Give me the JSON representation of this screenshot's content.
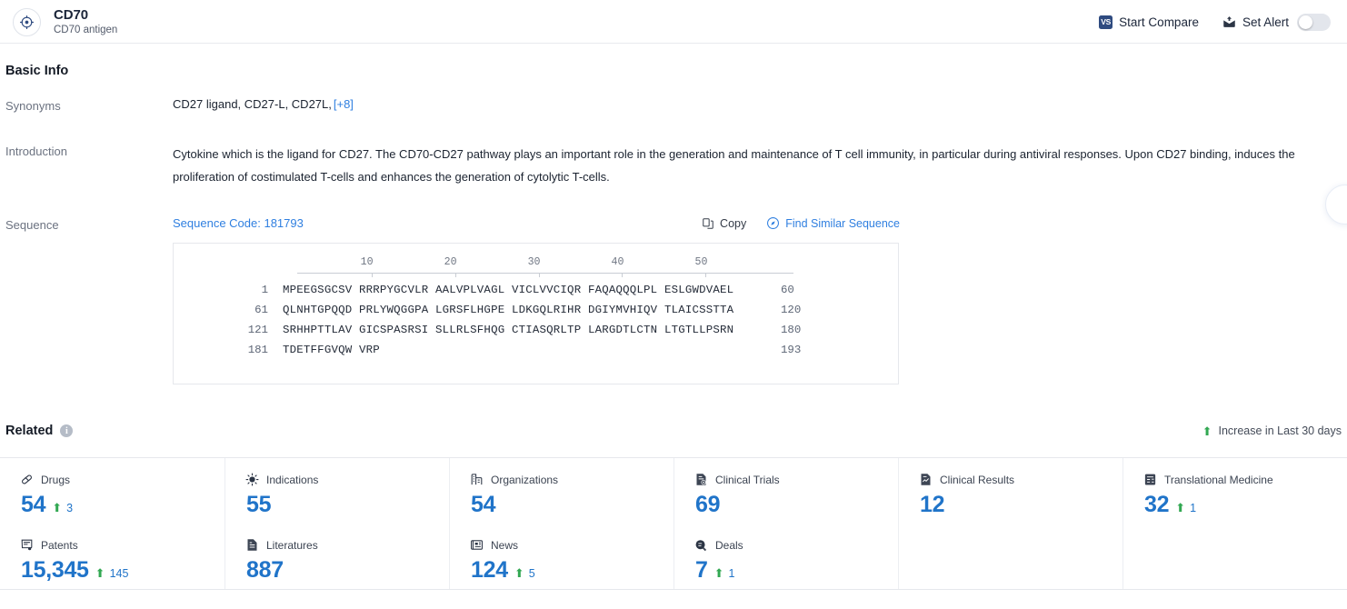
{
  "header": {
    "avatar_icon": "target-crosshair-icon",
    "entity_name": "CD70",
    "entity_subtitle": "CD70 antigen",
    "compare_badge": "VS",
    "compare_label": "Start Compare",
    "alert_icon": "alert-envelope-icon",
    "alert_label": "Set Alert",
    "alert_toggle_state": "off"
  },
  "basic_info": {
    "title": "Basic Info",
    "synonyms_label": "Synonyms",
    "synonyms_value": "CD27 ligand,  CD27-L,  CD27L,",
    "synonyms_more": "[+8]",
    "introduction_label": "Introduction",
    "introduction_text": "Cytokine which is the ligand for CD27. The CD70-CD27 pathway plays an important role in the generation and maintenance of T cell immunity, in particular during antiviral responses. Upon CD27 binding, induces the proliferation of costimulated T-cells and enhances the generation of cytolytic T-cells.",
    "sequence_label": "Sequence",
    "sequence_code": "Sequence Code: 181793",
    "copy_label": "Copy",
    "copy_icon": "copy-icon",
    "find_similar_label": "Find Similar Sequence",
    "find_similar_icon": "compass-icon"
  },
  "sequence": {
    "ruler_ticks": [
      10,
      20,
      30,
      40,
      50
    ],
    "lines": [
      {
        "start": "1",
        "residues": "MPEEGSGCSV RRRPYGCVLR AALVPLVAGL VICLVVCIQR FAQAQQQLPL ESLGWDVAEL",
        "end": "60"
      },
      {
        "start": "61",
        "residues": "QLNHTGPQQD PRLYWQGGPA LGRSFLHGPE LDKGQLRIHR DGIYMVHIQV TLAICSSTTA",
        "end": "120"
      },
      {
        "start": "121",
        "residues": "SRHHPTTLAV GICSPASRSI SLLRLSFHQG CTIASQRLTP LARGDTLCTN LTGTLLPSRN",
        "end": "180"
      },
      {
        "start": "181",
        "residues": "TDETFFGVQW VRP",
        "end": "193"
      }
    ]
  },
  "related": {
    "title": "Related",
    "info_icon": "info-icon",
    "legend_arrow": "up-arrow-icon",
    "legend_label": "Increase in Last 30 days",
    "cards": [
      {
        "icon": "capsule-icon",
        "label": "Drugs",
        "value": "54",
        "delta": "3"
      },
      {
        "icon": "virus-icon",
        "label": "Indications",
        "value": "55",
        "delta": ""
      },
      {
        "icon": "building-icon",
        "label": "Organizations",
        "value": "54",
        "delta": ""
      },
      {
        "icon": "clinical-trial-icon",
        "label": "Clinical Trials",
        "value": "69",
        "delta": ""
      },
      {
        "icon": "clinical-result-icon",
        "label": "Clinical Results",
        "value": "12",
        "delta": ""
      },
      {
        "icon": "translational-icon",
        "label": "Translational Medicine",
        "value": "32",
        "delta": "1"
      },
      {
        "icon": "patent-icon",
        "label": "Patents",
        "value": "15,345",
        "delta": "145"
      },
      {
        "icon": "literature-icon",
        "label": "Literatures",
        "value": "887",
        "delta": ""
      },
      {
        "icon": "news-icon",
        "label": "News",
        "value": "124",
        "delta": "5"
      },
      {
        "icon": "deal-icon",
        "label": "Deals",
        "value": "7",
        "delta": "1"
      }
    ]
  },
  "colors": {
    "accent_blue": "#2074c9",
    "link_blue": "#2f7fe0",
    "increase_green": "#32a852",
    "badge_navy": "#2f4b80"
  }
}
